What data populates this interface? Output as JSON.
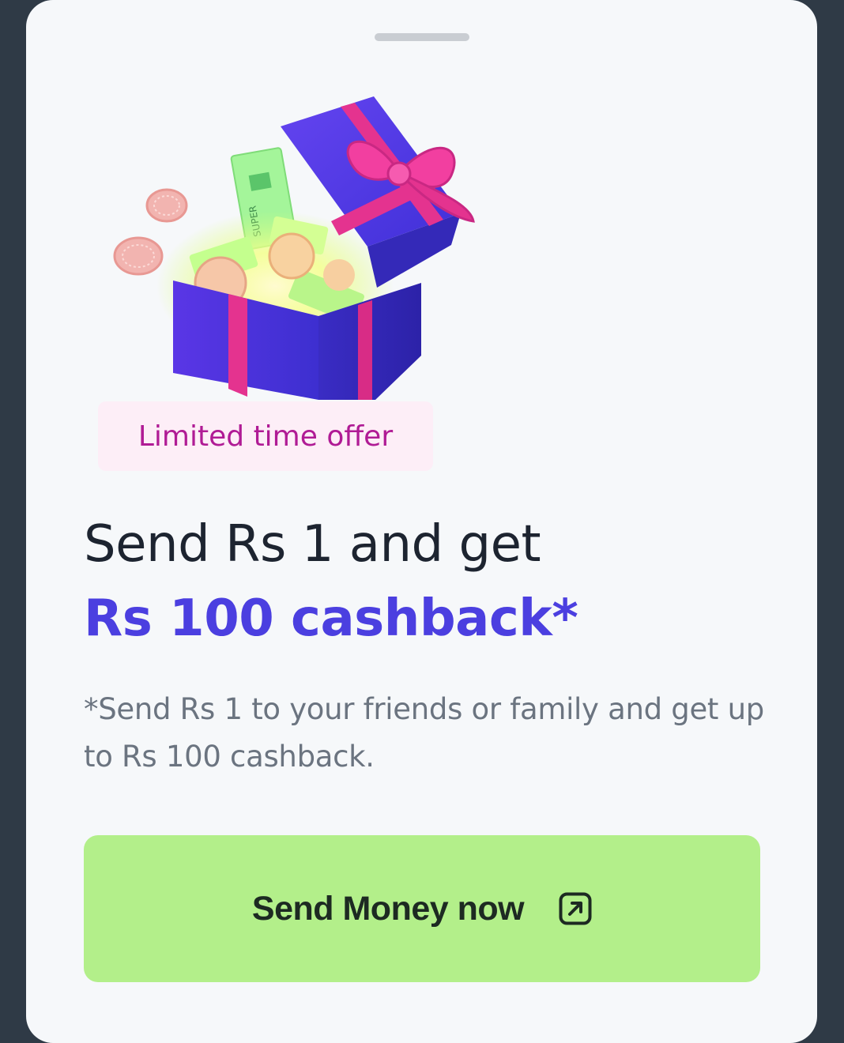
{
  "offer": {
    "badge": "Limited time offer",
    "headline_line1": "Send Rs 1 and get",
    "headline_line2": "Rs 100 cashback*",
    "note": "*Send Rs 1 to your friends or family and get up to Rs 100 cashback."
  },
  "cta": {
    "label": "Send Money now",
    "icon": "external-link-arrow-icon"
  },
  "hero": {
    "image": "gift-box-with-cash-illustration",
    "printed_text": "SUPER"
  },
  "colors": {
    "backdrop": "#2f3a46",
    "sheet": "#f6f8fa",
    "accent": "#4b3fe0",
    "badge_bg": "#fdeef7",
    "badge_text": "#b01b95",
    "cta_bg": "#b3ef8a"
  }
}
